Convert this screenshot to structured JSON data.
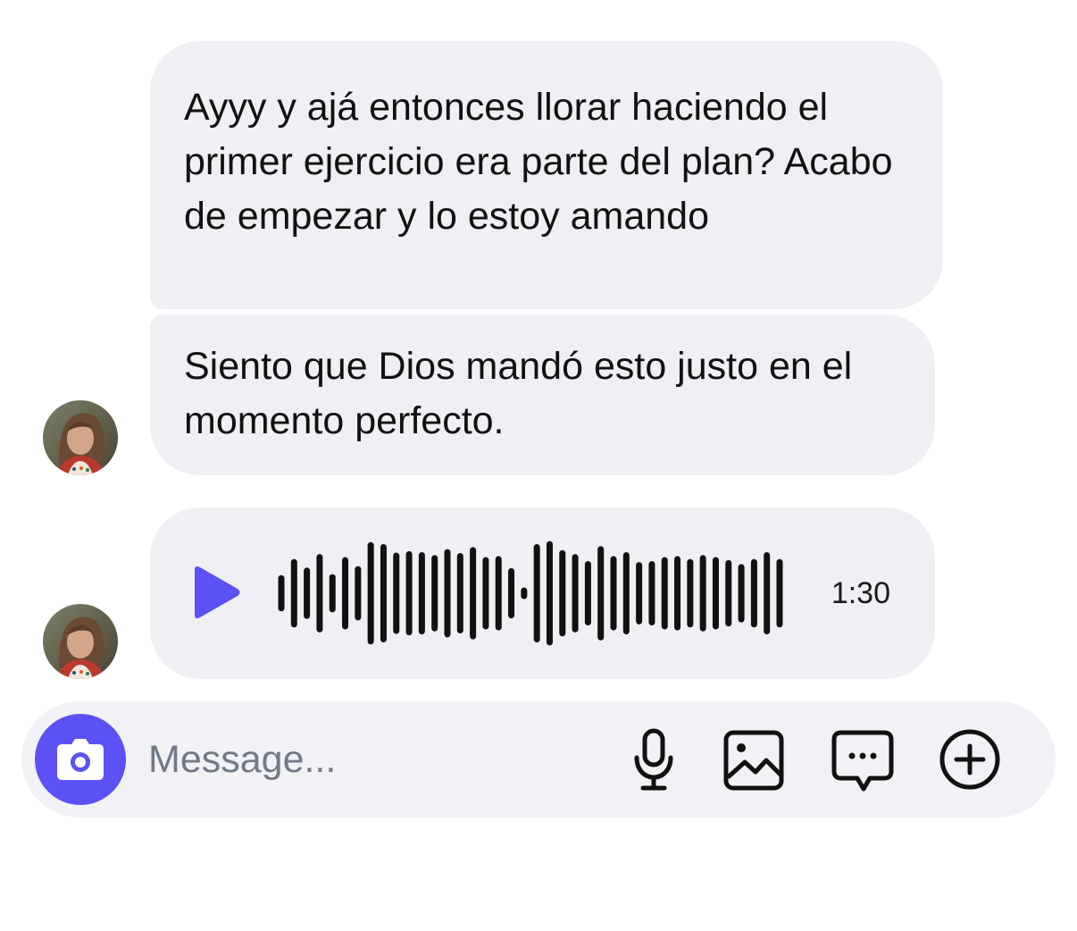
{
  "messages": [
    {
      "type": "text",
      "text": "Ayyy y ajá entonces llorar haciendo el primer ejercicio era parte del plan? Acabo de empezar y lo estoy amando"
    },
    {
      "type": "text",
      "text": "Siento que Dios mandó esto justo en el momento perfecto."
    },
    {
      "type": "voice",
      "duration": "1:30",
      "waveform_levels": [
        0.3,
        0.62,
        0.45,
        0.72,
        0.32,
        0.66,
        0.48,
        0.96,
        0.92,
        0.75,
        0.78,
        0.76,
        0.7,
        0.82,
        0.74,
        0.86,
        0.66,
        0.68,
        0.44,
        0.05,
        0.92,
        0.98,
        0.8,
        0.72,
        0.58,
        0.88,
        0.68,
        0.76,
        0.56,
        0.58,
        0.66,
        0.68,
        0.62,
        0.7,
        0.66,
        0.6,
        0.52,
        0.62,
        0.76,
        0.62
      ]
    }
  ],
  "composer": {
    "placeholder": "Message..."
  },
  "colors": {
    "accent": "#5b51f5",
    "bubble": "#efeff4",
    "composer_bg": "#f2f2f6",
    "text": "#111111",
    "placeholder": "#717986",
    "waveform": "#111111"
  },
  "icons": {
    "camera": "camera-icon",
    "microphone": "microphone-icon",
    "image": "image-icon",
    "chat": "chat-bubble-icon",
    "add": "plus-circle-icon",
    "play": "play-icon"
  }
}
